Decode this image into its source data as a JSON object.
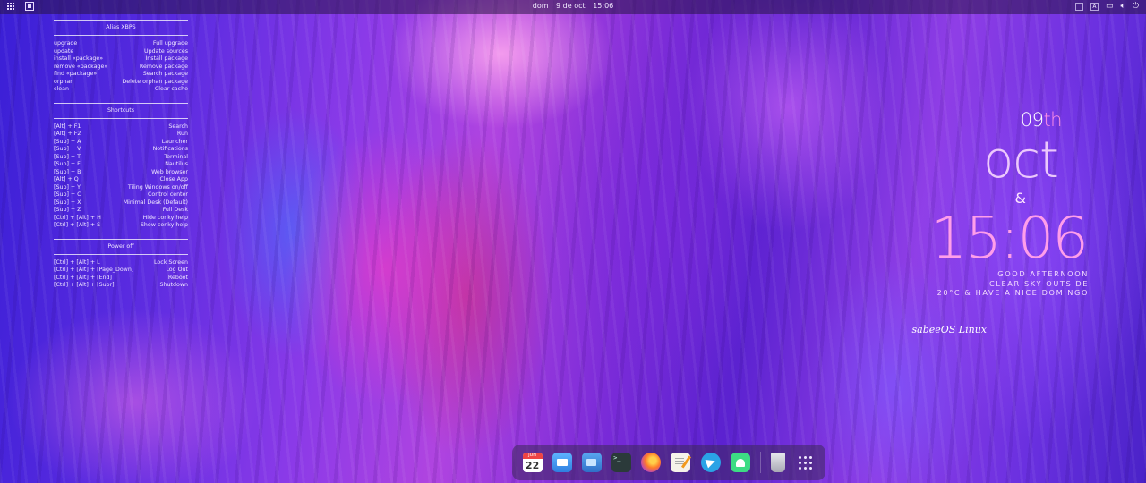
{
  "topbar": {
    "clock": {
      "day": "dom",
      "date": "9 de oct",
      "time": "15:06"
    },
    "tray": {
      "keyboard_a": "A",
      "keyboard_b": "A"
    }
  },
  "conky": {
    "alias": {
      "title": "Alias XBPS",
      "rows": [
        {
          "cmd": "upgrade",
          "desc": "Full upgrade"
        },
        {
          "cmd": "update",
          "desc": "Update sources"
        },
        {
          "cmd": "install «package»",
          "desc": "Install package"
        },
        {
          "cmd": "remove «package»",
          "desc": "Remove package"
        },
        {
          "cmd": "find «package»",
          "desc": "Search package"
        },
        {
          "cmd": "orphan",
          "desc": "Delete orphan package"
        },
        {
          "cmd": "clean",
          "desc": "Clear cache"
        }
      ]
    },
    "shortcuts": {
      "title": "Shortcuts",
      "rows": [
        {
          "cmd": "[Alt] + F1",
          "desc": "Search"
        },
        {
          "cmd": "[Alt] + F2",
          "desc": "Run"
        },
        {
          "cmd": "[Sup] + A",
          "desc": "Launcher"
        },
        {
          "cmd": "[Sup] + V",
          "desc": "Notifications"
        },
        {
          "cmd": "[Sup] + T",
          "desc": "Terminal"
        },
        {
          "cmd": "[Sup] + F",
          "desc": "Nautilus"
        },
        {
          "cmd": "[Sup] + B",
          "desc": "Web browser"
        },
        {
          "cmd": "[Alt] + Q",
          "desc": "Close App"
        },
        {
          "cmd": "[Sup] + Y",
          "desc": "Tiling Windows on/off"
        },
        {
          "cmd": "[Sup] + C",
          "desc": "Control center"
        },
        {
          "cmd": "[Sup] + X",
          "desc": "Minimal Desk (Default)"
        },
        {
          "cmd": "[Sup] + Z",
          "desc": "Full Desk"
        },
        {
          "cmd": "[Ctrl] + [Alt] + H",
          "desc": "Hide conky help"
        },
        {
          "cmd": "[Ctrl] + [Alt] + S",
          "desc": "Show conky help"
        }
      ]
    },
    "power": {
      "title": "Power off",
      "rows": [
        {
          "cmd": "[Ctrl] + [Alt] + L",
          "desc": "Lock Screen"
        },
        {
          "cmd": "[Ctrl] + [Alt] + [Page_Down]",
          "desc": "Log Out"
        },
        {
          "cmd": "[Ctrl] + [Alt] + [End]",
          "desc": "Reboot"
        },
        {
          "cmd": "[Ctrl] + [Alt] + [Supr]",
          "desc": "Shutdown"
        }
      ]
    }
  },
  "clock_widget": {
    "day": "09",
    "day_suffix": "th",
    "month": "oct",
    "amp": "&",
    "time": "15:06",
    "line1": "GOOD AFTERNOON",
    "line2": "CLEAR SKY OUTSIDE",
    "line3": "20°C & HAVE A NICE DOMINGO",
    "brand": "sabeeOS Linux"
  },
  "dock": {
    "calendar_month": "JUN",
    "calendar_day": "22",
    "terminal_prompt": ">_",
    "icons": [
      "calendar-icon",
      "mail-icon",
      "files-icon",
      "terminal-icon",
      "firefox-icon",
      "text-editor-icon",
      "telegram-icon",
      "android-icon",
      "trash-icon",
      "app-grid-icon"
    ]
  }
}
